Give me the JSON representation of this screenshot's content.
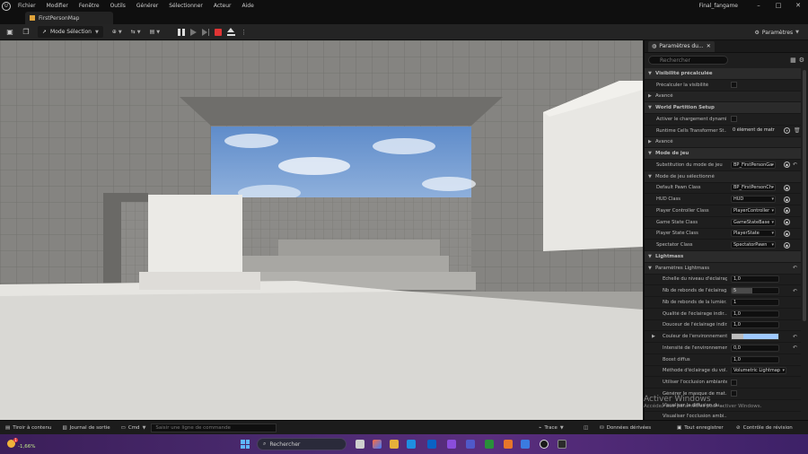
{
  "titlebar": {
    "menu": [
      "Fichier",
      "Modifier",
      "Fenêtre",
      "Outils",
      "Générer",
      "Sélectionner",
      "Acteur",
      "Aide"
    ],
    "project": "Final_fangame"
  },
  "tabs": {
    "map": "FirstPersonMap"
  },
  "toolbar": {
    "mode": "Mode Sélection",
    "settings": "Paramètres"
  },
  "details": {
    "tab_title": "Paramètres du...",
    "search_placeholder": "Rechercher",
    "rows": {
      "vis_section": "Visibilité précalculée",
      "vis_label": "Précalculer la visibilité",
      "advanced1": "Avancé",
      "wp_section": "World Partition Setup",
      "wp_load": "Activer le chargement dynamiq",
      "wp_runtime": "Runtime Cells Transformer St...",
      "wp_runtime_val": "0 élément de matr",
      "advanced2": "Avancé",
      "game_section": "Mode de jeu",
      "game_override": "Substitution du mode de jeu",
      "game_override_val": "BP_FirstPersonGa",
      "game_selected": "Mode de jeu sélectionné",
      "pawn": "Default Pawn Class",
      "pawn_val": "BP_FirstPersonCh",
      "hud": "HUD Class",
      "hud_val": "HUD",
      "pc": "Player Controller Class",
      "pc_val": "PlayerController",
      "gs": "Game State Class",
      "gs_val": "GameStateBase",
      "ps": "Player State Class",
      "ps_val": "PlayerState",
      "spec": "Spectator Class",
      "spec_val": "SpectatorPawn",
      "lm_section": "Lightmass",
      "lm_params": "Paramètres Lightmass",
      "lm_scale": "Échelle du niveau d'éclairag...",
      "lm_scale_val": "1,0",
      "lm_bounces": "Nb de rebonds de l'éclairag...",
      "lm_bounces_val": "5",
      "lm_sky": "Nb de rebonds de la lumièr...",
      "lm_sky_val": "1",
      "lm_quality": "Qualité de l'éclairage indir...",
      "lm_quality_val": "1,0",
      "lm_smooth": "Douceur de l'éclairage indir...",
      "lm_smooth_val": "1,0",
      "lm_env_color": "Couleur de l'environnement",
      "lm_env_int": "Intensité de l'environnement",
      "lm_env_int_val": "0,0",
      "lm_boost": "Boost diffus",
      "lm_boost_val": "1,0",
      "lm_method": "Méthode d'éclairage du vol...",
      "lm_method_val": "Volumetric Lightmap",
      "lm_ao": "Utiliser l'occlusion ambiante",
      "lm_mask": "Générer le masque de mat...",
      "lm_diff": "Visualiser la diffusion du...",
      "lm_vis_ao": "Visualiser l'occlusion ambi..."
    }
  },
  "watermark": {
    "title": "Activer Windows",
    "subtitle": "Accédez aux paramètres pour activer Windows."
  },
  "statusbar": {
    "drawer": "Tiroir à contenu",
    "log": "Journal de sortie",
    "cmd": "Cmd",
    "cmd_placeholder": "Saisir une ligne de commande",
    "trace": "Trace",
    "derived": "Données dérivées",
    "save_all": "Tout enregistrer",
    "revision": "Contrôle de révision"
  },
  "taskbar": {
    "weather": "-1,66%",
    "badge": "1",
    "search": "Rechercher"
  },
  "colors": {
    "sky": "#7fa6d9",
    "env_color": "#9fc9ff",
    "stop": "#e03434"
  }
}
